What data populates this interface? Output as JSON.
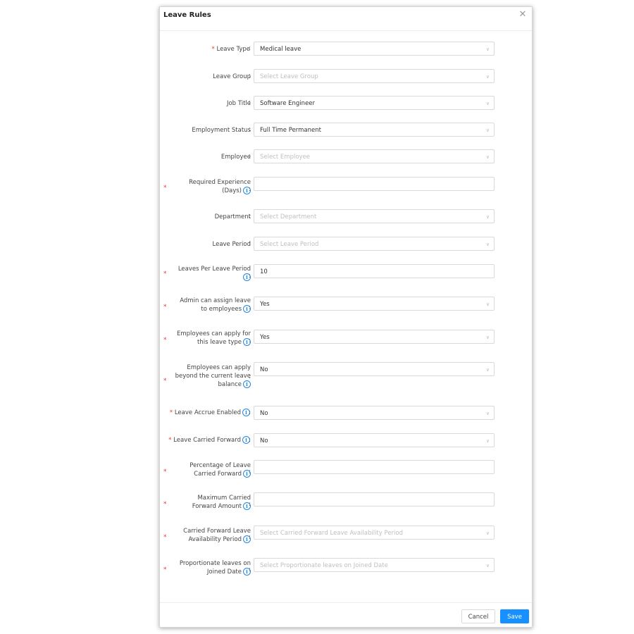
{
  "modal": {
    "title": "Leave Rules",
    "close_glyph": "✕"
  },
  "icons": {
    "info": "ⓘ",
    "chevron": "∨",
    "required": "*"
  },
  "fields": {
    "leave_type": {
      "label": "Leave Type",
      "value": "Medical leave",
      "required": true
    },
    "leave_group": {
      "label": "Leave Group",
      "placeholder": "Select Leave Group"
    },
    "job_title": {
      "label": "Job Title",
      "value": "Software Engineer"
    },
    "employment_status": {
      "label": "Employment Status",
      "value": "Full Time Permanent"
    },
    "employee": {
      "label": "Employee",
      "placeholder": "Select Employee"
    },
    "required_experience": {
      "label_line1": "Required Experience",
      "label_line2": "(Days)",
      "value": ""
    },
    "department": {
      "label": "Department",
      "placeholder": "Select Department"
    },
    "leave_period": {
      "label": "Leave Period",
      "placeholder": "Select Leave Period"
    },
    "leaves_per_period": {
      "label_line1": "Leaves Per Leave Period",
      "value": "10"
    },
    "admin_assign": {
      "label_line1": "Admin can assign leave",
      "label_line2": "to employees",
      "value": "Yes"
    },
    "employees_apply": {
      "label_line1": "Employees can apply for",
      "label_line2": "this leave type",
      "value": "Yes"
    },
    "beyond_balance": {
      "label_line1": "Employees can apply",
      "label_line2": "beyond the current leave",
      "label_line3": "balance",
      "value": "No"
    },
    "accrue_enabled": {
      "label": "Leave Accrue Enabled",
      "value": "No"
    },
    "carried_forward": {
      "label": "Leave Carried Forward",
      "value": "No"
    },
    "pct_carried": {
      "label_line1": "Percentage of Leave",
      "label_line2": "Carried Forward",
      "value": ""
    },
    "max_carried": {
      "label_line1": "Maximum Carried",
      "label_line2": "Forward Amount",
      "value": ""
    },
    "cf_availability": {
      "label_line1": "Carried Forward Leave",
      "label_line2": "Availability Period",
      "placeholder": "Select Carried Forward Leave Availability Period"
    },
    "proportionate": {
      "label_line1": "Proportionate leaves on",
      "label_line2": "Joined Date",
      "placeholder": "Select Proportionate leaves on Joined Date"
    }
  },
  "footer": {
    "cancel_label": "Cancel",
    "save_label": "Save"
  }
}
